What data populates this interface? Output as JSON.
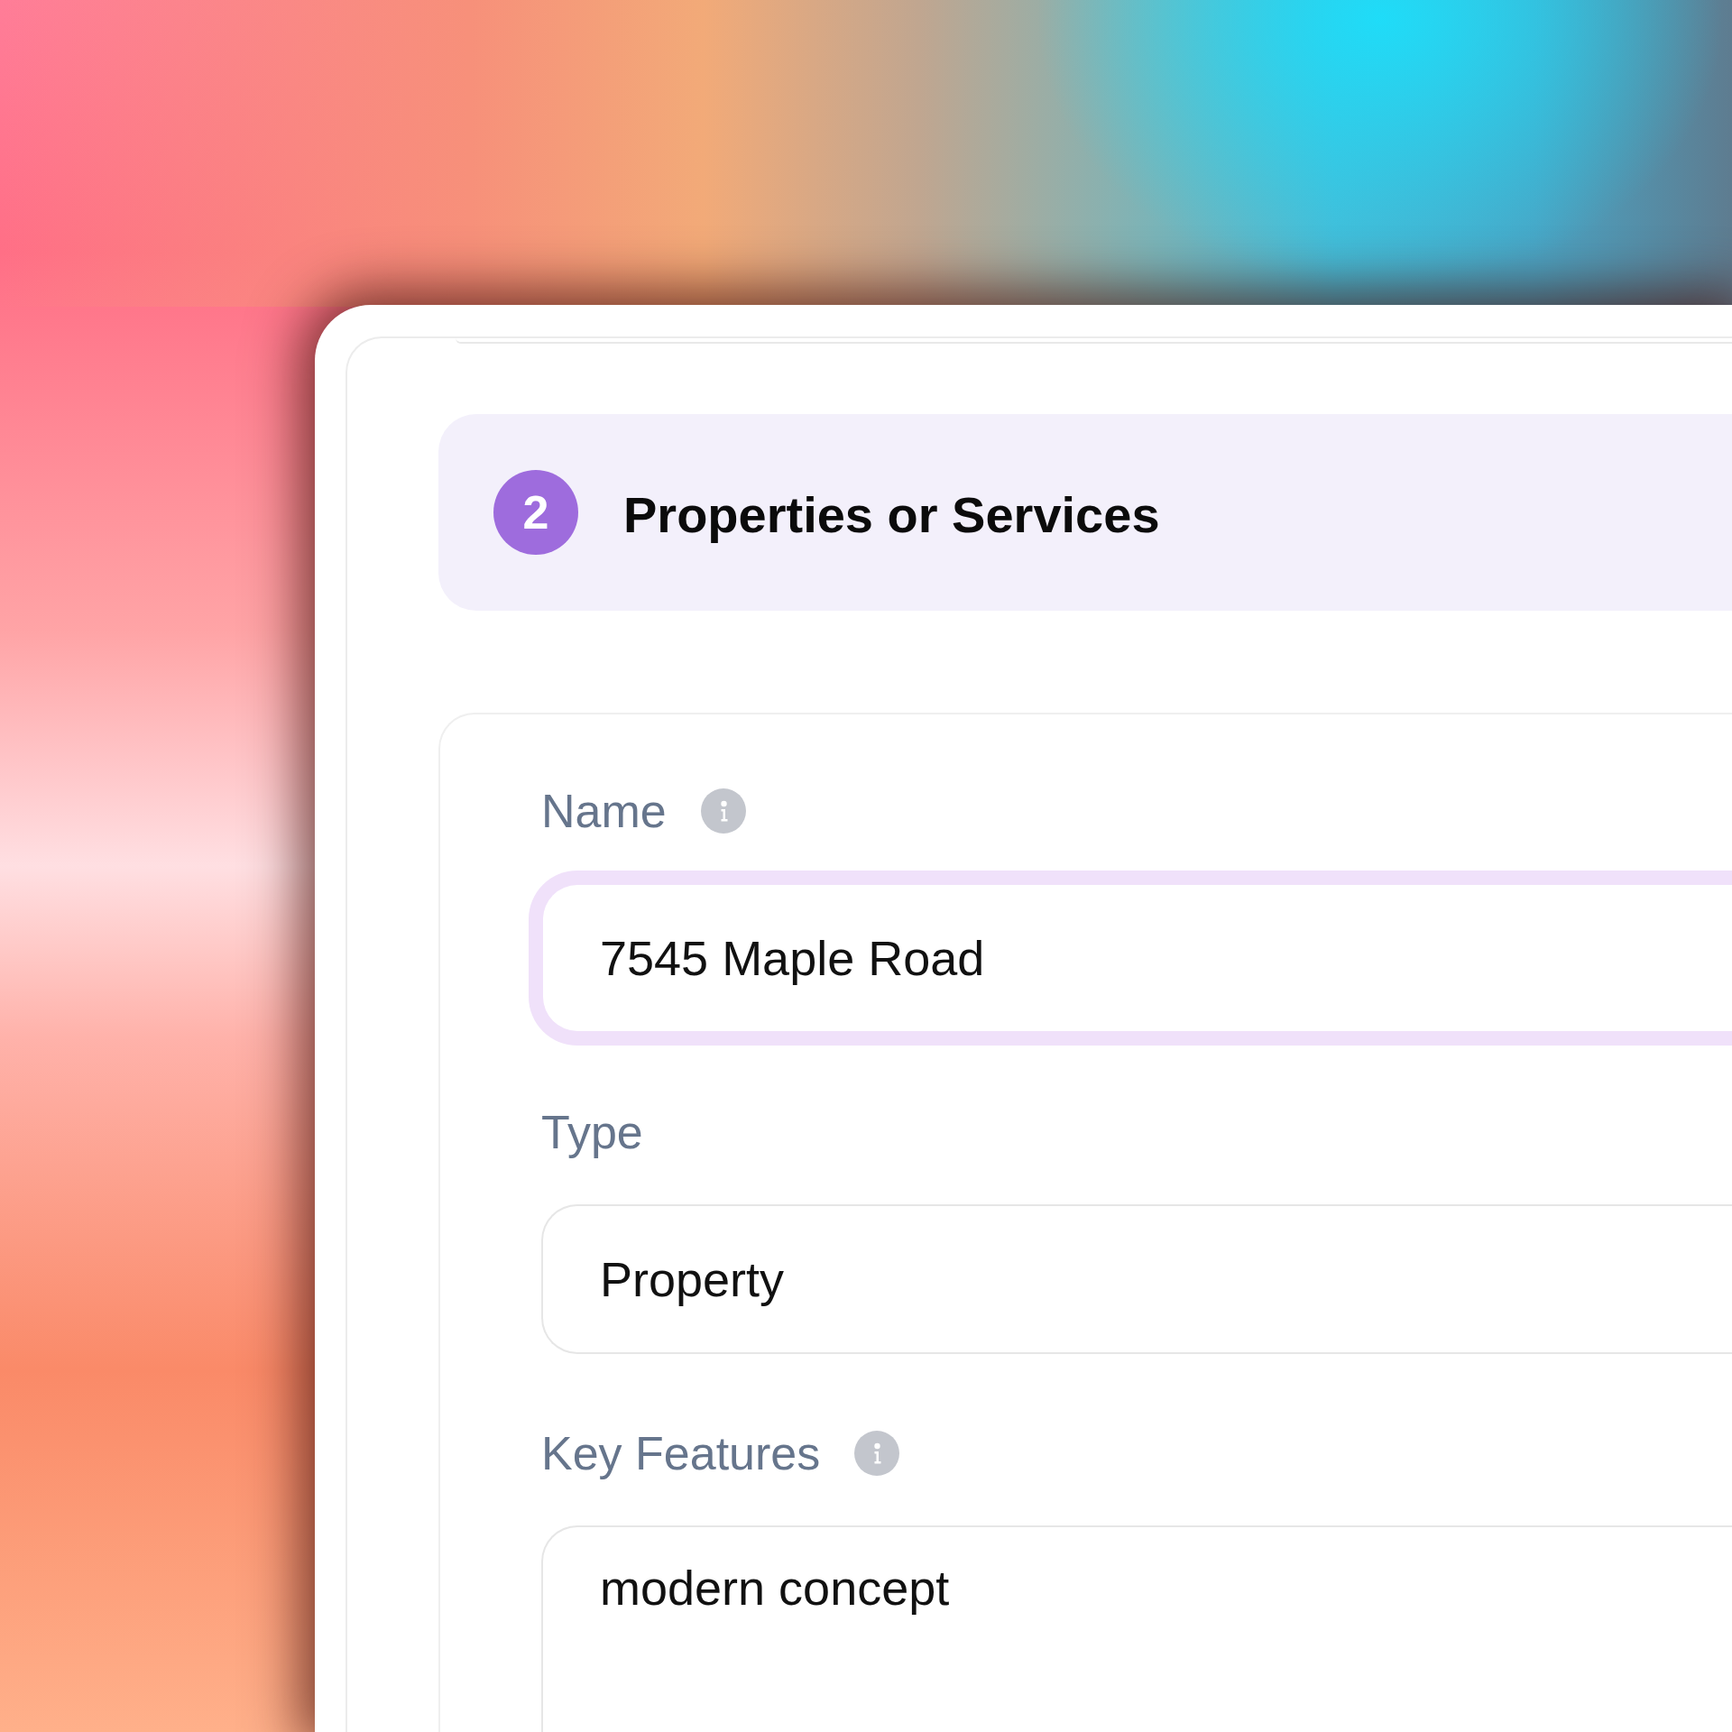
{
  "section": {
    "number": "2",
    "title": "Properties or Services"
  },
  "fields": [
    {
      "kind": "input",
      "label": "Name",
      "info": true,
      "value": "7545 Maple Road",
      "focused": true
    },
    {
      "kind": "input",
      "label": "Type",
      "info": false,
      "value": "Property",
      "focused": false
    },
    {
      "kind": "textarea",
      "label": "Key Features",
      "info": true,
      "value": "modern concept",
      "focused": false
    }
  ]
}
